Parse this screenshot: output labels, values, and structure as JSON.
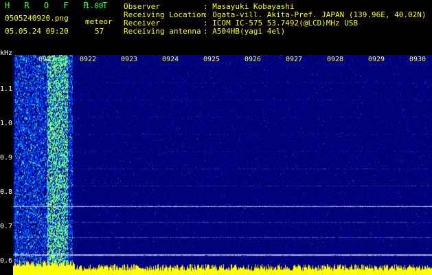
{
  "app": {
    "title": "H R O F F T",
    "version": "1.00",
    "filename": "0505240920.png",
    "datetime": "05.05.24 09:20",
    "meteor_label": "meteor",
    "meteor_count": "57"
  },
  "info": {
    "labels": [
      "Observer",
      "Receiving Location",
      "Receiver",
      "Receiving antenna"
    ],
    "values": [
      ": Masayuki Kobayashi",
      ": Ogata-vill. Akita-Pref. JAPAN (139.96E, 40.02N)",
      ": ICOM IC-575 53.7492(@LCD)MHz USB",
      ": A504HB(yagi 4el)"
    ]
  },
  "axis": {
    "unit": "kHz",
    "freq_ticks": [
      "1.1",
      "1.0",
      "0.9",
      "0.8",
      "0.7",
      "0.6"
    ],
    "time_ticks": [
      "0921",
      "0922",
      "0923",
      "0924",
      "0925",
      "0926",
      "0927",
      "0928",
      "0929",
      "0930"
    ]
  },
  "colors": {
    "background": "#00007a",
    "header_text": "#39ff39",
    "tick_text": "#ffff40",
    "signal": "#7fffbf",
    "meteor_burst": "#ffff00"
  }
}
